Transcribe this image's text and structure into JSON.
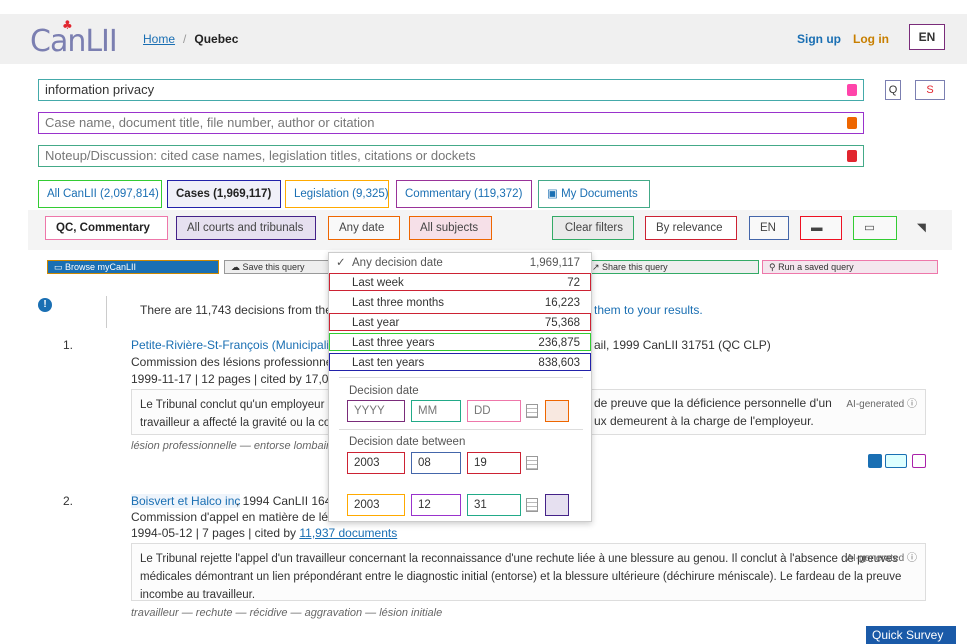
{
  "header": {
    "logo": "CanLII",
    "home": "Home",
    "crumb": "Quebec",
    "sign_up": "Sign up",
    "log_in": "Log in",
    "lang": "EN"
  },
  "search": {
    "main": "information privacy",
    "case_placeholder": "Case name, document title, file number, author or citation",
    "noteup_placeholder": "Noteup/Discussion: cited case names, legislation titles, citations or dockets"
  },
  "tabs": [
    {
      "label": "All CanLII (2,097,814)"
    },
    {
      "label": "Cases (1,969,117)"
    },
    {
      "label": "Legislation (9,325)"
    },
    {
      "label": "Commentary (119,372)"
    },
    {
      "label": "My Documents"
    }
  ],
  "filters": {
    "scope": "QC, Commentary",
    "courts": "All courts and tribunals",
    "date": "Any date",
    "subjects": "All subjects",
    "clear": "Clear filters",
    "sort": "By relevance",
    "lang": "EN"
  },
  "tools": {
    "browse": "Browse myCanLII",
    "save": "Save this query",
    "share": "Share this query",
    "run": "Run a saved query"
  },
  "date_dropdown": {
    "options": [
      {
        "label": "Any decision date",
        "count": "1,969,117"
      },
      {
        "label": "Last week",
        "count": "72"
      },
      {
        "label": "Last three months",
        "count": "16,223"
      },
      {
        "label": "Last year",
        "count": "75,368"
      },
      {
        "label": "Last three years",
        "count": "236,875"
      },
      {
        "label": "Last ten years",
        "count": "838,603"
      }
    ],
    "decision_date_label": "Decision date",
    "yyyy": "YYYY",
    "mm": "MM",
    "dd": "DD",
    "between_label": "Decision date between",
    "from": {
      "y": "2003",
      "m": "08",
      "d": "19"
    },
    "to": {
      "y": "2003",
      "m": "12",
      "d": "31"
    }
  },
  "notice": {
    "text_before": "There are 11,743 decisions from the S",
    "text_after": "them to your results."
  },
  "results": [
    {
      "num": "1.",
      "title": "Petite-Rivière-St-François (Municipalité d",
      "title_tail": "ail, 1999 CanLII 31751 (QC CLP)",
      "court": "Commission des lésions professionnelle",
      "meta": "1999-11-17  |  12 pages  |  cited by 17,0",
      "summary_a": "Le Tribunal conclut qu'un employeur n",
      "summary_a_tail": "de preuve que la déficience personnelle d'un",
      "summary_b": "travailleur a affecté la gravité ou la con",
      "summary_b_tail": "ux demeurent à la charge de l'employeur.",
      "ai": "AI-generated",
      "keywords": "lésion professionnelle — entorse lombaire"
    },
    {
      "num": "2.",
      "title": "Boisvert et Halco inc",
      "title_tail": ", 1994 CanLII 16436",
      "court": "Commission d'appel en matière de lésio",
      "meta": "1994-05-12  |  7 pages  |  cited by",
      "cited": "11,937 documents",
      "summary": "Le Tribunal rejette l'appel d'un travailleur concernant la reconnaissance d'une rechute liée à une blessure au genou. Il conclut à l'absence de preuves médicales démontrant un lien prépondérant entre le diagnostic initial (entorse) et la blessure ultérieure (déchirure méniscale). Le fardeau de la preuve incombe au travailleur.",
      "ai": "AI-generated",
      "keywords": "travailleur — rechute — récidive — aggravation — lésion initiale"
    }
  ],
  "quick_survey": "Quick Survey"
}
